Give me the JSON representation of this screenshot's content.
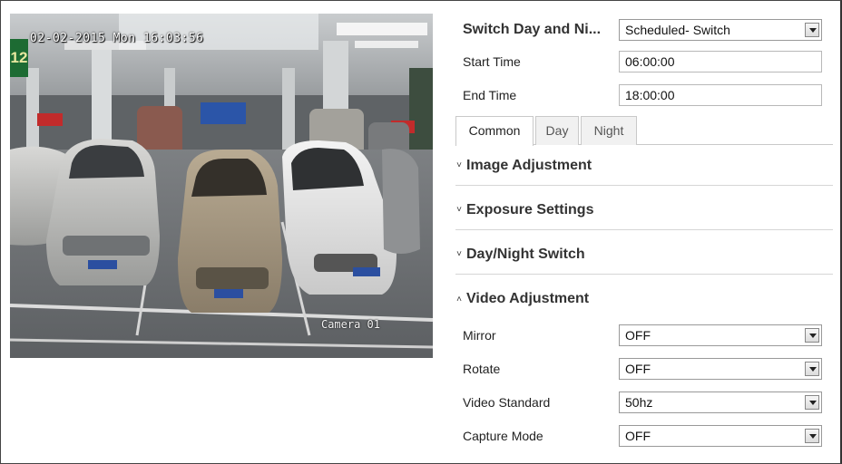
{
  "preview": {
    "osd_time": "02-02-2015 Mon 16:03:56",
    "osd_camera": "Camera 01",
    "osd_badge": "12"
  },
  "settings": {
    "switch_day_night": {
      "label": "Switch Day and Ni...",
      "value": "Scheduled- Switch"
    },
    "start_time": {
      "label": "Start Time",
      "value": "06:00:00"
    },
    "end_time": {
      "label": "End Time",
      "value": "18:00:00"
    }
  },
  "tabs": [
    {
      "label": "Common",
      "active": true
    },
    {
      "label": "Day",
      "active": false
    },
    {
      "label": "Night",
      "active": false
    }
  ],
  "sections": [
    {
      "label": "Image Adjustment",
      "expanded": false
    },
    {
      "label": "Exposure Settings",
      "expanded": false
    },
    {
      "label": "Day/Night Switch",
      "expanded": false
    },
    {
      "label": "Video Adjustment",
      "expanded": true
    }
  ],
  "video_adjustment": {
    "mirror": {
      "label": "Mirror",
      "value": "OFF"
    },
    "rotate": {
      "label": "Rotate",
      "value": "OFF"
    },
    "video_standard": {
      "label": "Video Standard",
      "value": "50hz"
    },
    "capture_mode": {
      "label": "Capture Mode",
      "value": "OFF"
    }
  }
}
